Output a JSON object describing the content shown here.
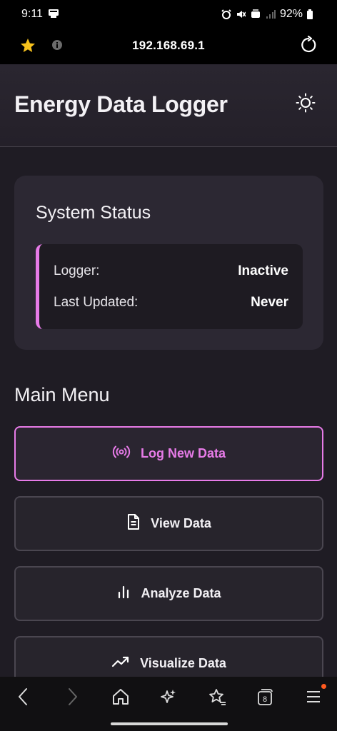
{
  "status_bar": {
    "time": "9:11",
    "battery": "92%"
  },
  "url_bar": {
    "url": "192.168.69.1"
  },
  "header": {
    "title": "Energy Data Logger"
  },
  "system_status": {
    "title": "System Status",
    "rows": [
      {
        "label": "Logger:",
        "value": "Inactive"
      },
      {
        "label": "Last Updated:",
        "value": "Never"
      }
    ]
  },
  "main_menu": {
    "title": "Main Menu",
    "buttons": [
      {
        "label": "Log New Data",
        "icon": "broadcast-icon"
      },
      {
        "label": "View Data",
        "icon": "document-icon"
      },
      {
        "label": "Analyze Data",
        "icon": "bar-chart-icon"
      },
      {
        "label": "Visualize Data",
        "icon": "trending-up-icon"
      }
    ]
  },
  "colors": {
    "accent": "#e77be8",
    "background": "#1f1c24",
    "card": "#2c2833"
  }
}
